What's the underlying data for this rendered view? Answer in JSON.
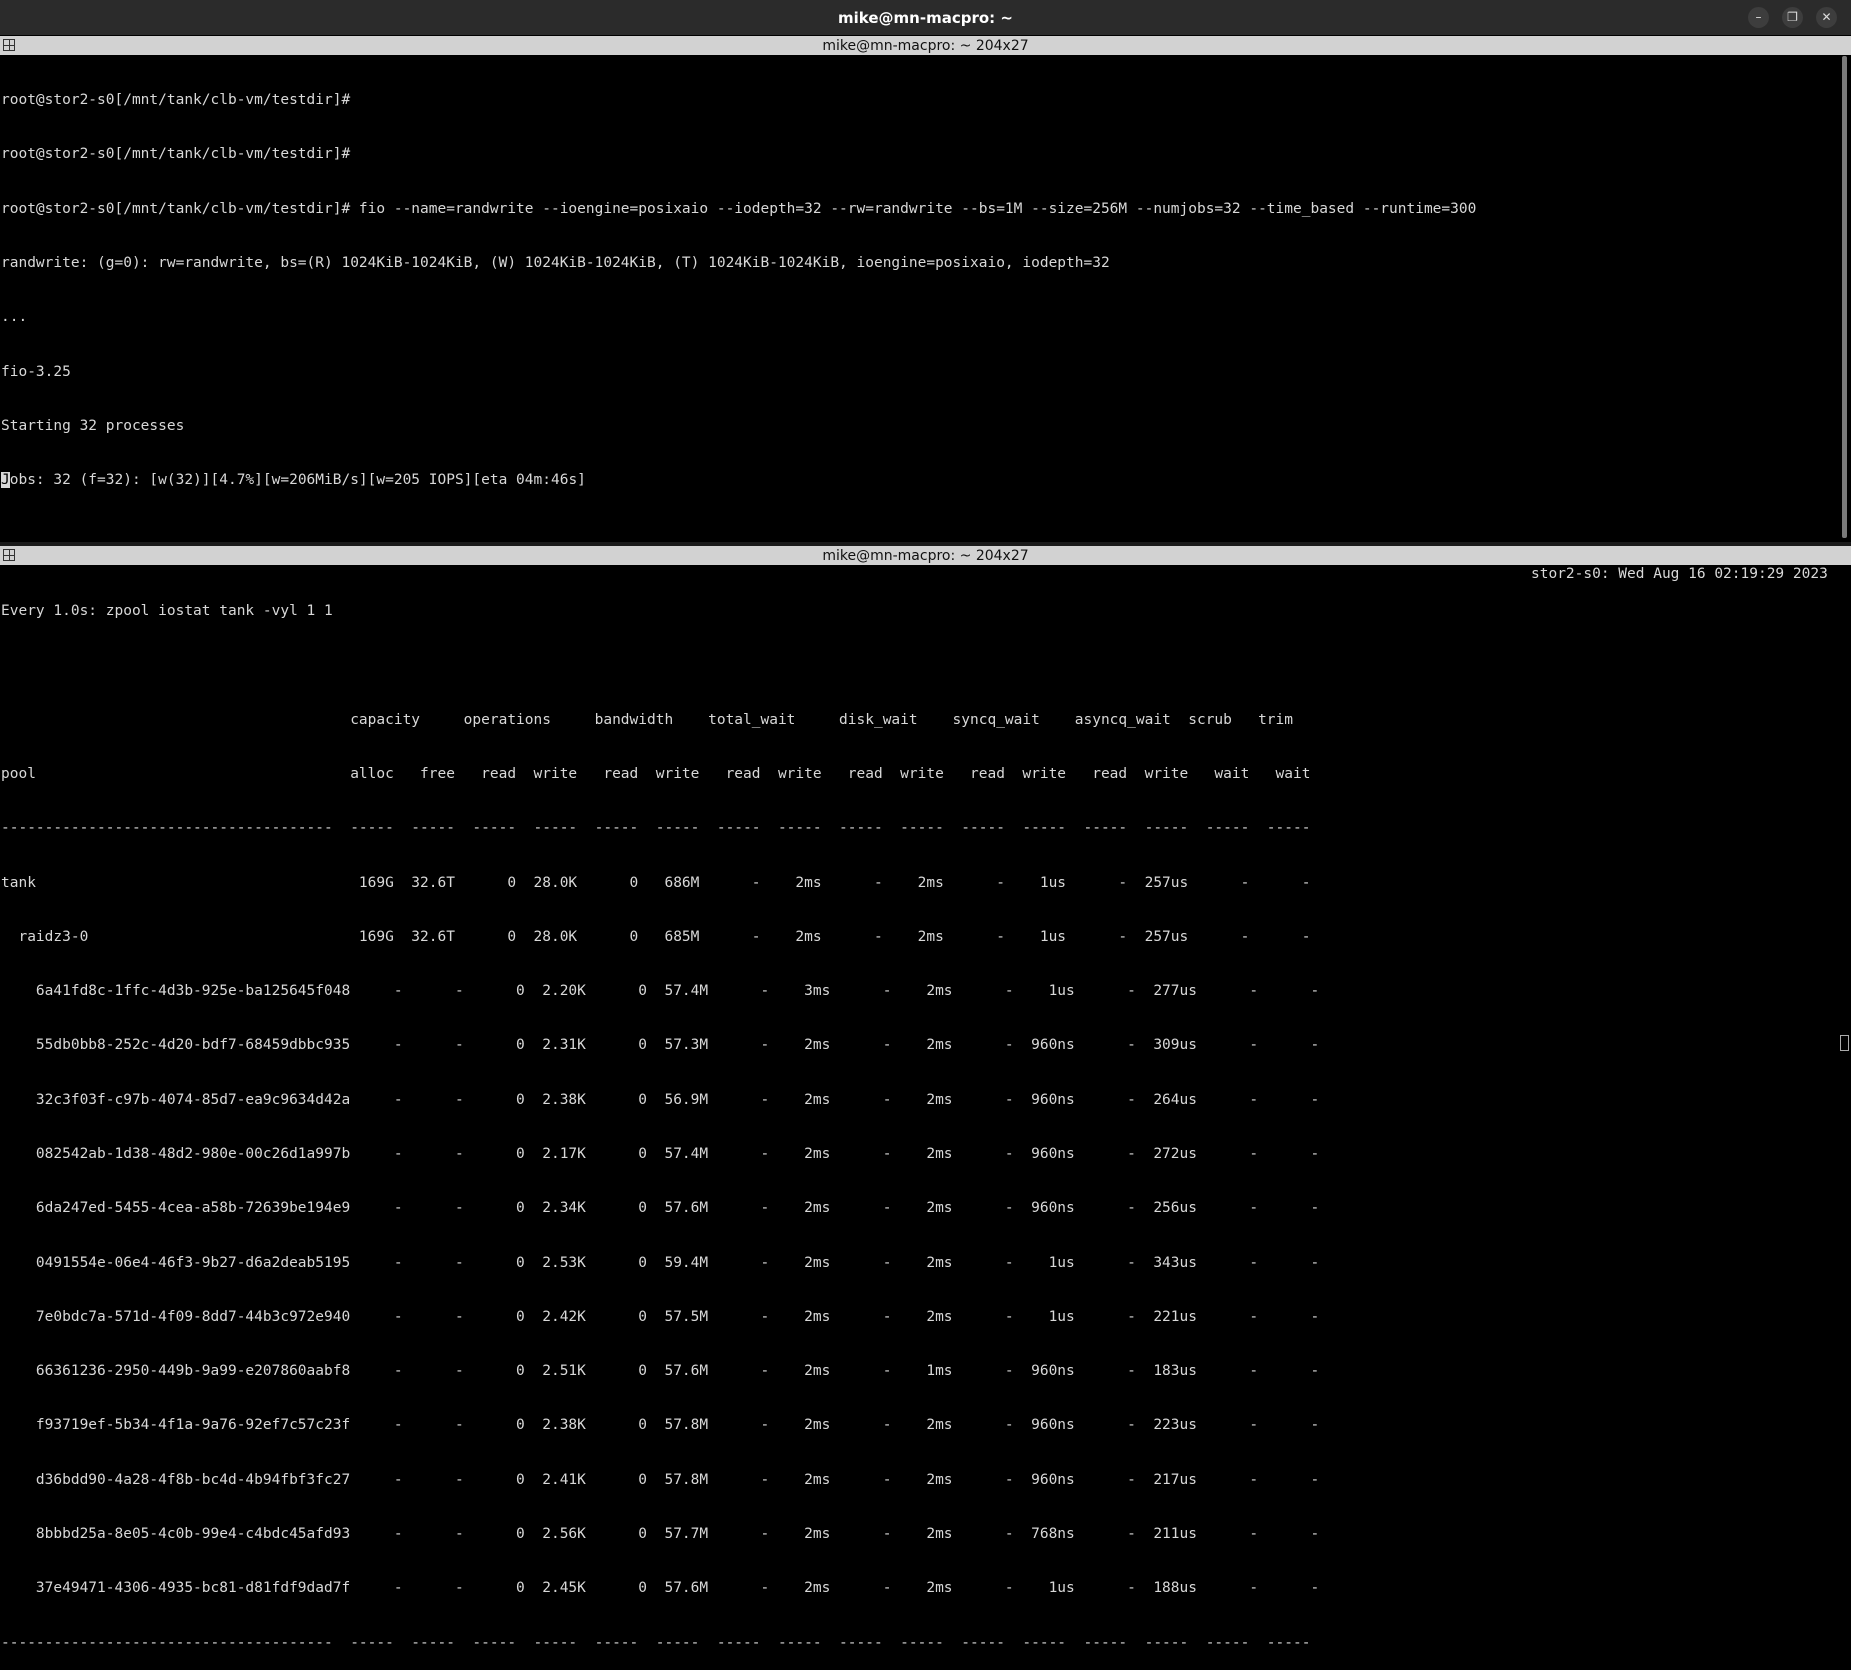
{
  "window": {
    "title": "mike@mn-macpro: ~",
    "buttons": {
      "minimize": "–",
      "maximize": "❐",
      "close": "✕"
    }
  },
  "top_pane": {
    "title": "mike@mn-macpro: ~ 204x27",
    "lines": [
      "root@stor2-s0[/mnt/tank/clb-vm/testdir]#",
      "root@stor2-s0[/mnt/tank/clb-vm/testdir]#",
      "root@stor2-s0[/mnt/tank/clb-vm/testdir]# fio --name=randwrite --ioengine=posixaio --iodepth=32 --rw=randwrite --bs=1M --size=256M --numjobs=32 --time_based --runtime=300",
      "randwrite: (g=0): rw=randwrite, bs=(R) 1024KiB-1024KiB, (W) 1024KiB-1024KiB, (T) 1024KiB-1024KiB, ioengine=posixaio, iodepth=32",
      "...",
      "fio-3.25",
      "Starting 32 processes"
    ],
    "jobs_cursor_char": "J",
    "jobs_line_rest": "obs: 32 (f=32): [w(32)][4.7%][w=206MiB/s][w=205 IOPS][eta 04m:46s]"
  },
  "bottom_pane": {
    "title": "mike@mn-macpro: ~ 204x27",
    "watch_header": "Every 1.0s: zpool iostat tank -vyl 1 1",
    "status_right": "stor2-s0: Wed Aug 16 02:19:29 2023",
    "header_line1": "                                        capacity     operations     bandwidth    total_wait     disk_wait    syncq_wait    asyncq_wait  scrub   trim",
    "header_line2": "pool                                    alloc   free   read  write   read  write   read  write   read  write   read  write   read  write   wait   wait",
    "separator": "--------------------------------------  -----  -----  -----  -----  -----  -----  -----  -----  -----  -----  -----  -----  -----  -----  -----  -----",
    "rows": [
      "tank                                     169G  32.6T      0  28.0K      0   686M      -    2ms      -    2ms      -    1us      -  257us      -      -",
      "  raidz3-0                               169G  32.6T      0  28.0K      0   685M      -    2ms      -    2ms      -    1us      -  257us      -      -",
      "    6a41fd8c-1ffc-4d3b-925e-ba125645f048     -      -      0  2.20K      0  57.4M      -    3ms      -    2ms      -    1us      -  277us      -      -",
      "    55db0bb8-252c-4d20-bdf7-68459dbbc935     -      -      0  2.31K      0  57.3M      -    2ms      -    2ms      -  960ns      -  309us      -      -",
      "    32c3f03f-c97b-4074-85d7-ea9c9634d42a     -      -      0  2.38K      0  56.9M      -    2ms      -    2ms      -  960ns      -  264us      -      -",
      "    082542ab-1d38-48d2-980e-00c26d1a997b     -      -      0  2.17K      0  57.4M      -    2ms      -    2ms      -  960ns      -  272us      -      -",
      "    6da247ed-5455-4cea-a58b-72639be194e9     -      -      0  2.34K      0  57.6M      -    2ms      -    2ms      -  960ns      -  256us      -      -",
      "    0491554e-06e4-46f3-9b27-d6a2deab5195     -      -      0  2.53K      0  59.4M      -    2ms      -    2ms      -    1us      -  343us      -      -",
      "    7e0bdc7a-571d-4f09-8dd7-44b3c972e940     -      -      0  2.42K      0  57.5M      -    2ms      -    2ms      -    1us      -  221us      -      -",
      "    66361236-2950-449b-9a99-e207860aabf8     -      -      0  2.51K      0  57.6M      -    2ms      -    1ms      -  960ns      -  183us      -      -",
      "    f93719ef-5b34-4f1a-9a76-92ef7c57c23f     -      -      0  2.38K      0  57.8M      -    2ms      -    2ms      -  960ns      -  223us      -      -",
      "    d36bdd90-4a28-4f8b-bc4d-4b94fbf3fc27     -      -      0  2.41K      0  57.8M      -    2ms      -    2ms      -  960ns      -  217us      -      -",
      "    8bbbd25a-8e05-4c0b-99e4-c4bdc45afd93     -      -      0  2.56K      0  57.7M      -    2ms      -    2ms      -  768ns      -  211us      -      -",
      "    37e49471-4306-4935-bc81-d81fdf9dad7f     -      -      0  2.45K      0  57.6M      -    2ms      -    2ms      -    1us      -  188us      -      -"
    ]
  }
}
